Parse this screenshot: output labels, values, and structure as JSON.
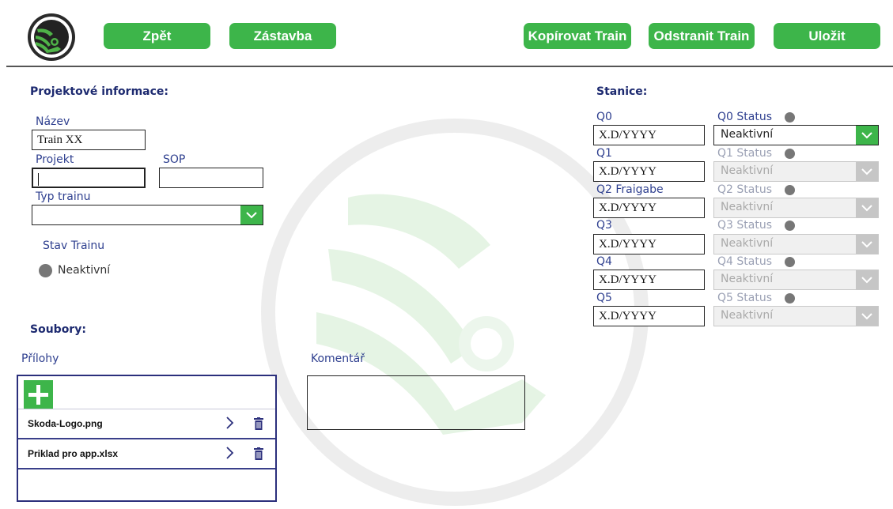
{
  "header": {
    "buttons": {
      "back": "Zpět",
      "stop": "Zástavba",
      "copy": "Kopírovat Train",
      "remove": "Odstranit Train",
      "save": "Uložit"
    }
  },
  "project": {
    "title": "Projektové informace:",
    "name_label": "Název",
    "name_value": "Train XX",
    "project_label": "Projekt",
    "project_value": "",
    "sop_label": "SOP",
    "sop_value": "",
    "type_label": "Typ trainu",
    "type_value": "",
    "state_label": "Stav Trainu",
    "state_value": "Neaktivní"
  },
  "stations": {
    "title": "Stanice:",
    "items": [
      {
        "label": "Q0",
        "value": "X.D/YYYY",
        "status_label": "Q0 Status",
        "status_value": "Neaktivní"
      },
      {
        "label": "Q1",
        "value": "X.D/YYYY",
        "status_label": "Q1 Status",
        "status_value": "Neaktivní"
      },
      {
        "label": "Q2 Fraigabe",
        "value": "X.D/YYYY",
        "status_label": "Q2 Status",
        "status_value": "Neaktivní"
      },
      {
        "label": "Q3",
        "value": "X.D/YYYY",
        "status_label": "Q3 Status",
        "status_value": "Neaktivní"
      },
      {
        "label": "Q4",
        "value": "X.D/YYYY",
        "status_label": "Q4 Status",
        "status_value": "Neaktivní"
      },
      {
        "label": "Q5",
        "value": "X.D/YYYY",
        "status_label": "Q5 Status",
        "status_value": "Neaktivní"
      }
    ]
  },
  "files": {
    "title": "Soubory:",
    "attachments_label": "Přílohy",
    "comment_label": "Komentář",
    "comment_value": "",
    "items": [
      {
        "name": "Skoda-Logo.png"
      },
      {
        "name": "Priklad pro app.xlsx"
      }
    ]
  },
  "colors": {
    "accent": "#3db54a",
    "navy": "#1d2a70",
    "panel_border": "#2b2f7c"
  },
  "icons": [
    "skoda-logo-icon",
    "chevron-down-icon",
    "chevron-right-icon",
    "trash-icon",
    "plus-icon",
    "status-dot-icon"
  ]
}
